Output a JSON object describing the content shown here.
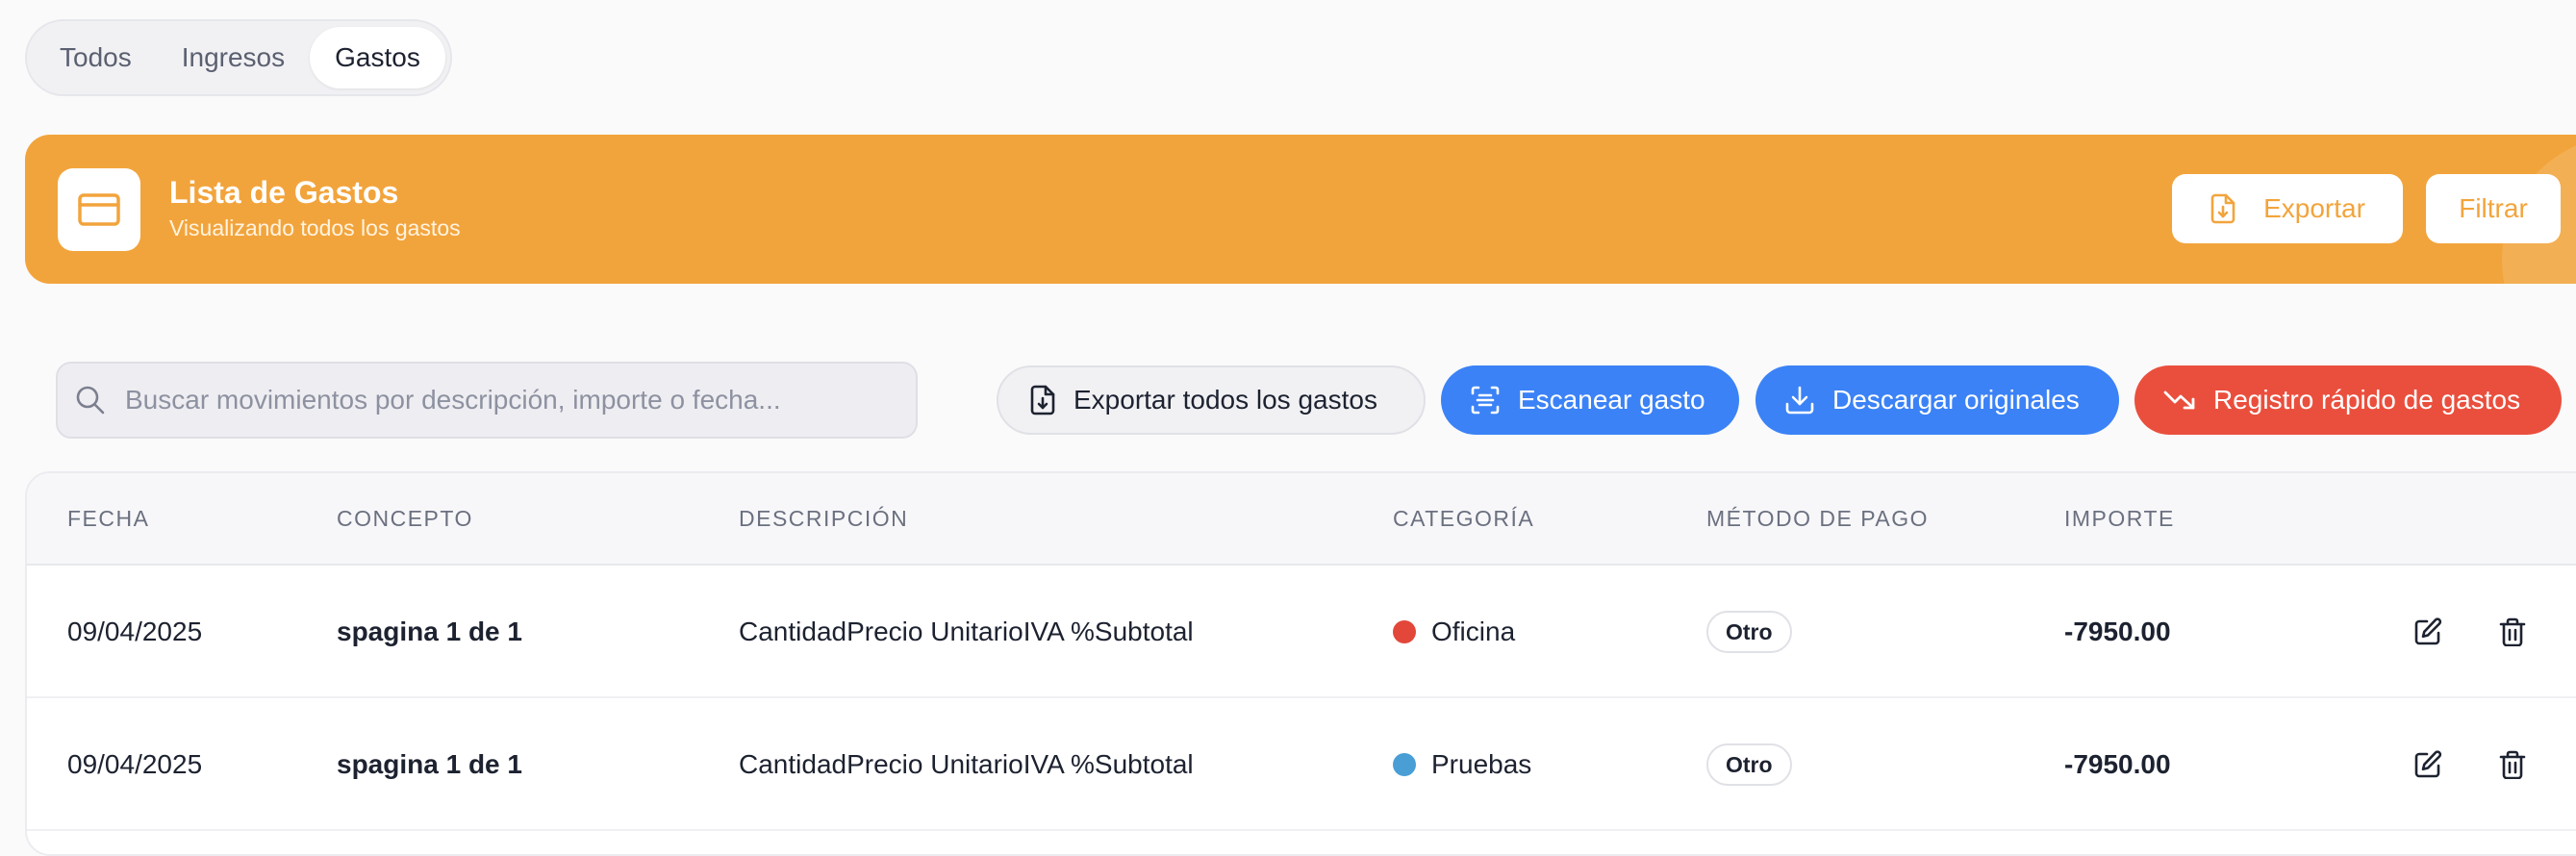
{
  "tabs": [
    {
      "label": "Todos"
    },
    {
      "label": "Ingresos"
    },
    {
      "label": "Gastos"
    }
  ],
  "banner": {
    "title": "Lista de Gastos",
    "subtitle": "Visualizando todos los gastos",
    "export_label": "Exportar",
    "filter_label": "Filtrar",
    "accent": "#f2a43c"
  },
  "toolbar": {
    "search_placeholder": "Buscar movimientos por descripción, importe o fecha...",
    "export_all_label": "Exportar todos los gastos",
    "scan_label": "Escanear gasto",
    "download_label": "Descargar originales",
    "quick_label": "Registro rápido de gastos",
    "blue": "#3b82f6",
    "red": "#ea4f3d"
  },
  "table": {
    "columns": [
      "FECHA",
      "CONCEPTO",
      "DESCRIPCIÓN",
      "CATEGORÍA",
      "MÉTODO DE PAGO",
      "IMPORTE"
    ],
    "rows": [
      {
        "fecha": "09/04/2025",
        "concepto": "spagina 1 de 1",
        "descripcion": "CantidadPrecio UnitarioIVA %Subtotal",
        "categoria": "Oficina",
        "categoria_color": "#e2473a",
        "metodo": "Otro",
        "importe": "-7950.00"
      },
      {
        "fecha": "09/04/2025",
        "concepto": "spagina 1 de 1",
        "descripcion": "CantidadPrecio UnitarioIVA %Subtotal",
        "categoria": "Pruebas",
        "categoria_color": "#4a9ed6",
        "metodo": "Otro",
        "importe": "-7950.00"
      }
    ]
  }
}
